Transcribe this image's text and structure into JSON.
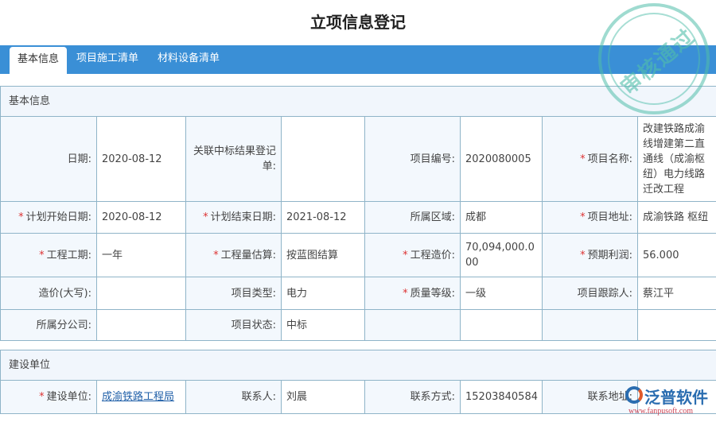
{
  "title": "立项信息登记",
  "tabs": [
    "基本信息",
    "项目施工清单",
    "材料设备清单"
  ],
  "sections": {
    "basic": "基本信息",
    "builder": "建设单位"
  },
  "fields": {
    "date_l": "日期:",
    "date_v": "2020-08-12",
    "bid_l": "关联中标结果登记单:",
    "bid_v": "",
    "code_l": "项目编号:",
    "code_v": "2020080005",
    "name_l": "项目名称:",
    "name_v": "改建铁路成渝线增建第二直通线（成渝枢纽）电力线路迁改工程",
    "start_l": "计划开始日期:",
    "start_v": "2020-08-12",
    "end_l": "计划结束日期:",
    "end_v": "2021-08-12",
    "region_l": "所属区域:",
    "region_v": "成都",
    "addr_l": "项目地址:",
    "addr_v": "成渝铁路 枢纽",
    "period_l": "工程工期:",
    "period_v": "一年",
    "est_l": "工程量估算:",
    "est_v": "按蓝图结算",
    "cost_l": "工程造价:",
    "cost_v": "70,094,000.000",
    "profit_l": "预期利润:",
    "profit_v": "56.000",
    "capital_l": "造价(大写):",
    "capital_v": "",
    "type_l": "项目类型:",
    "type_v": "电力",
    "quality_l": "质量等级:",
    "quality_v": "一级",
    "follow_l": "项目跟踪人:",
    "follow_v": "蔡江平",
    "branch_l": "所属分公司:",
    "branch_v": "",
    "status_l": "项目状态:",
    "status_v": "中标",
    "unit_l": "建设单位:",
    "unit_v": "成渝铁路工程局",
    "contact_l": "联系人:",
    "contact_v": "刘晨",
    "phone_l": "联系方式:",
    "phone_v": "15203840584",
    "uaddr_l": "联系地址:",
    "uaddr_v": ""
  },
  "stamp": "审核通过",
  "logo": {
    "name": "泛普软件",
    "url": "www.fanpusoft.com"
  }
}
